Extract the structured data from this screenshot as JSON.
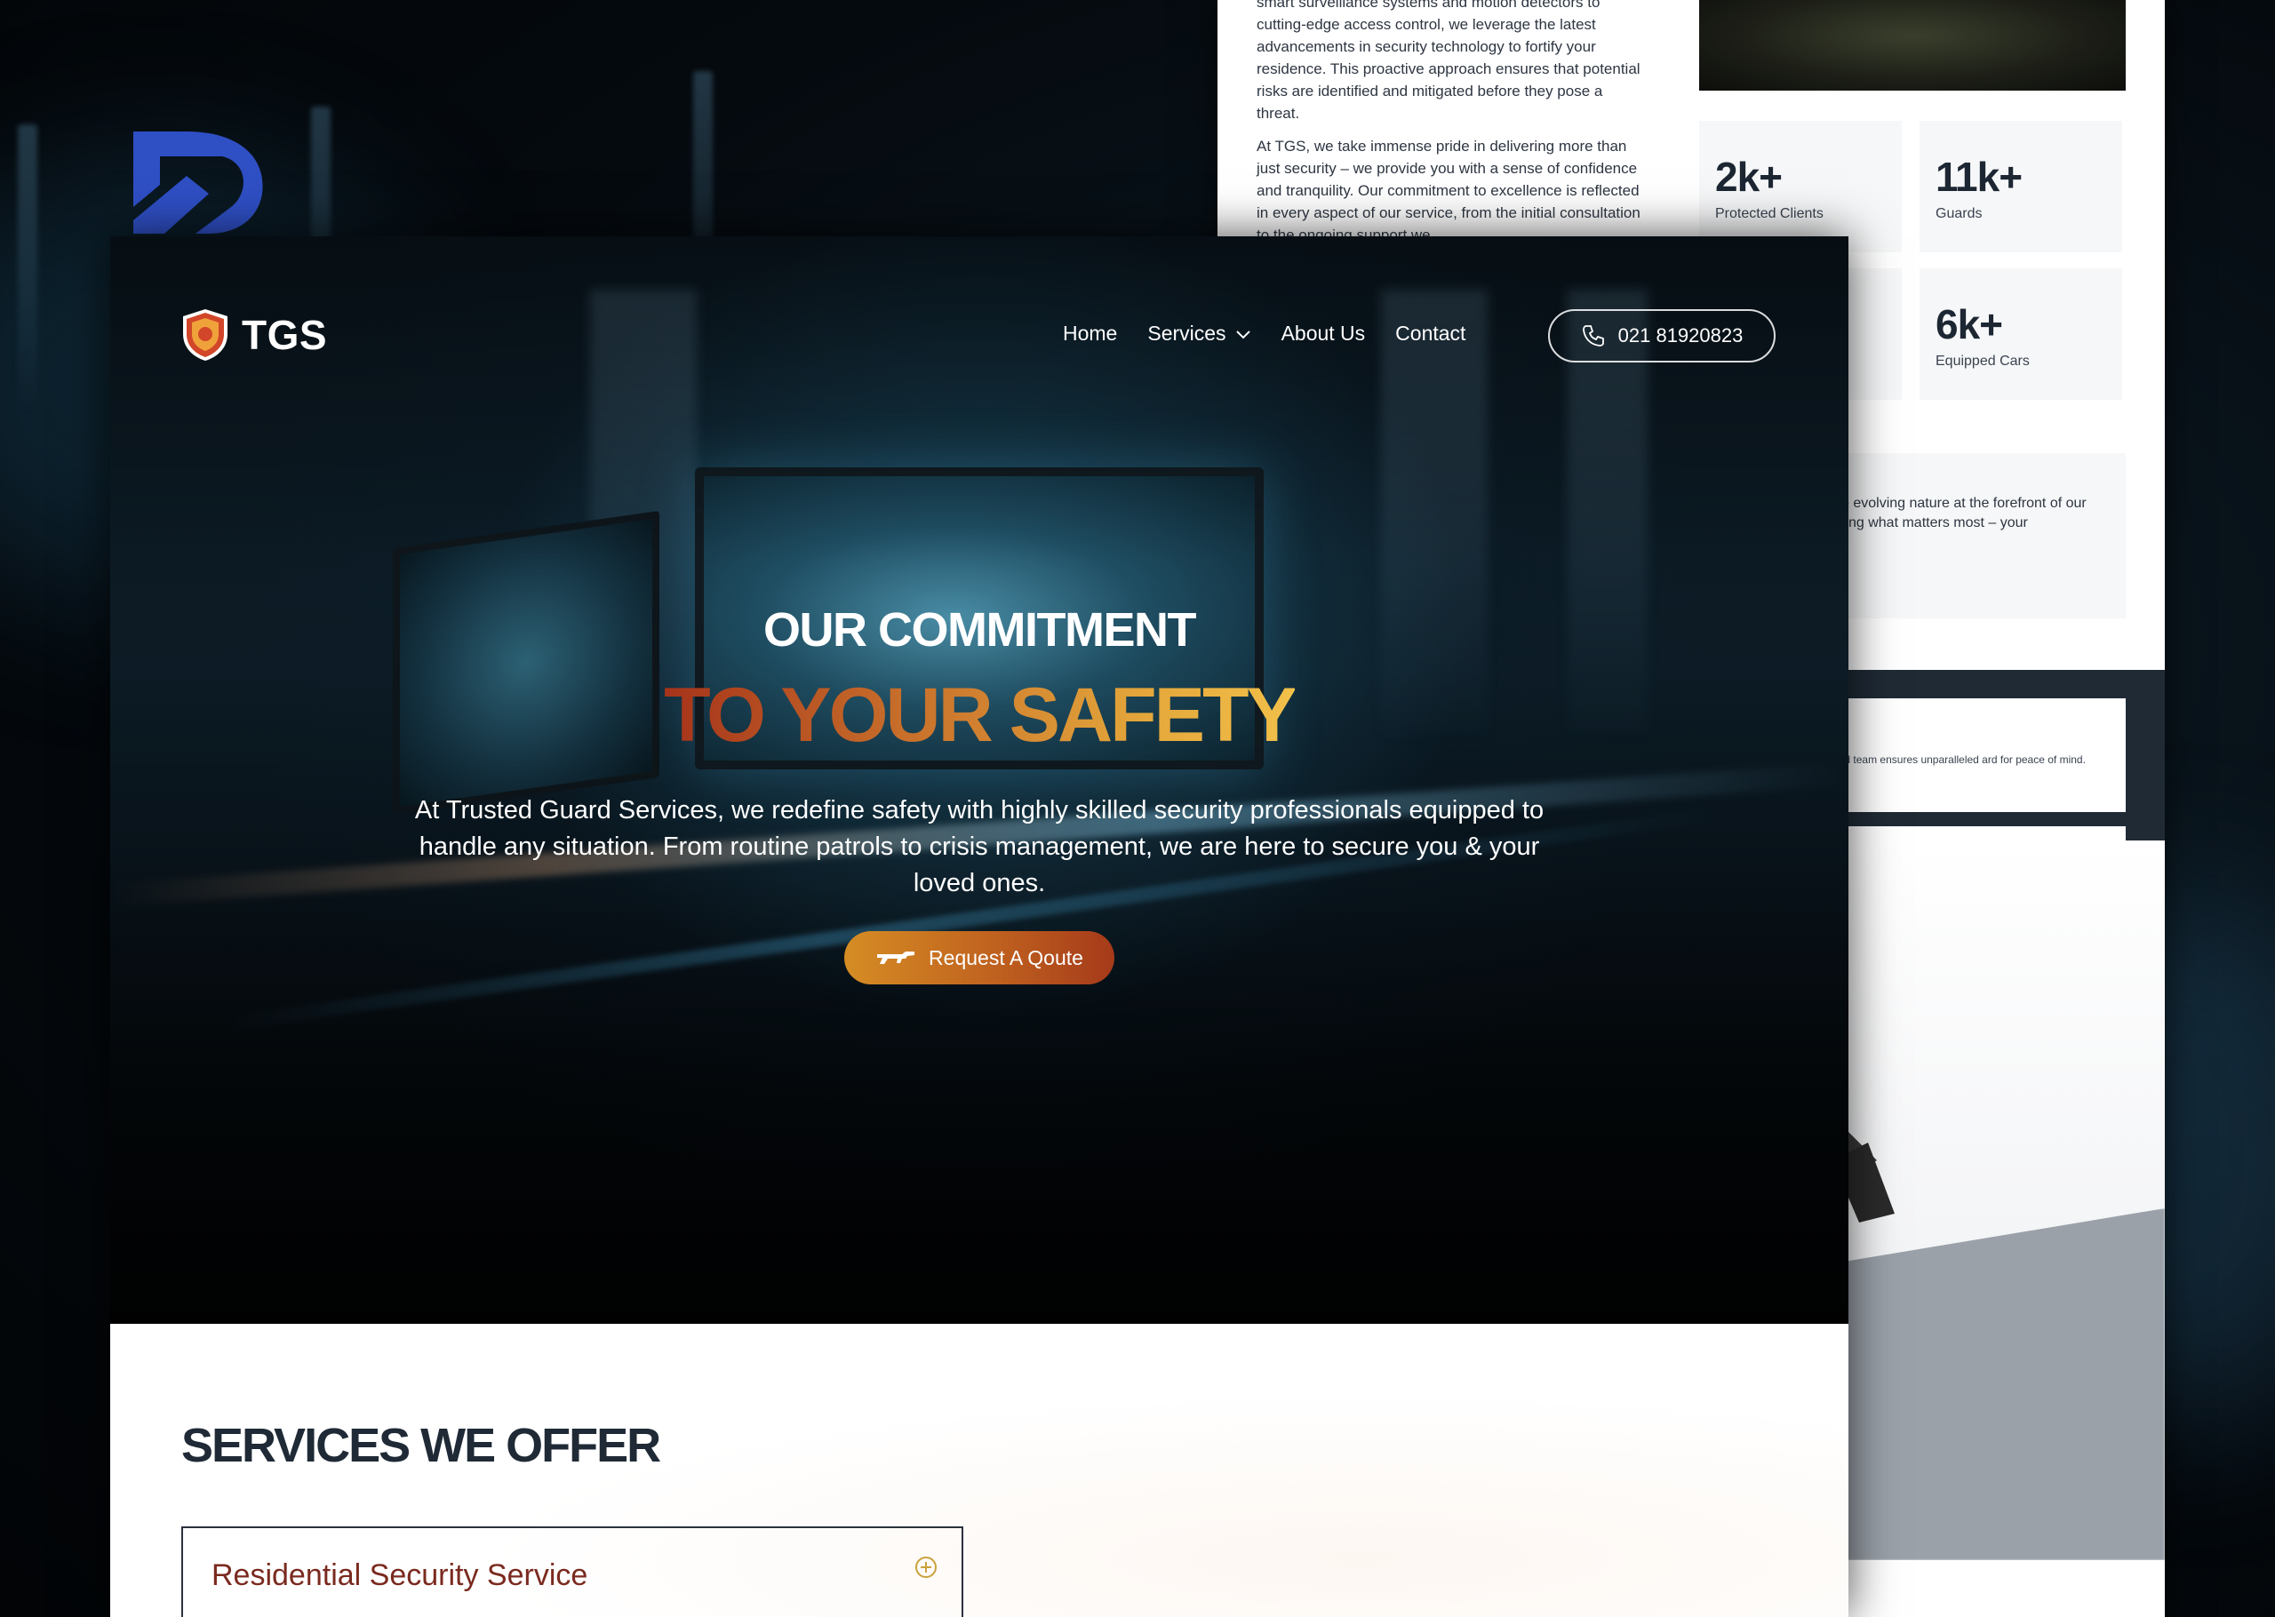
{
  "back_page": {
    "paragraph_1": "smart surveillance systems and motion detectors to cutting-edge access control, we leverage the latest advancements in security technology to fortify your residence. This proactive approach ensures that potential risks are identified and mitigated before they pose a threat.",
    "paragraph_2": "At TGS, we take immense pride in delivering more than just security – we provide you with a sense of confidence and tranquility. Our commitment to excellence is reflected in every aspect of our service, from the initial consultation to the ongoing support we",
    "stats": [
      {
        "value": "2k+",
        "label": "Protected Clients"
      },
      {
        "value": "11k+",
        "label": "Guards"
      },
      {
        "value": "6k+",
        "label": "Equipped Cars"
      }
    ],
    "gray_block_text": "We understand the evolving nature at the forefront of our efforts. With guarding what matters most – your",
    "white_card_text": "excellence, our dedicated team ensures unparalleled ard for peace of mind."
  },
  "header": {
    "logo_text": "TGS",
    "nav": [
      {
        "label": "Home"
      },
      {
        "label": "Services"
      },
      {
        "label": "About Us"
      },
      {
        "label": "Contact"
      }
    ],
    "phone": "021 81920823"
  },
  "hero": {
    "heading_line1": "OUR COMMITMENT",
    "heading_line2": "TO YOUR SAFETY",
    "description": "At Trusted Guard Services, we redefine safety with highly skilled security professionals equipped to handle any situation. From routine patrols to crisis management, we are here to secure you & your loved ones.",
    "cta_label": "Request A Qoute"
  },
  "services": {
    "title": "SERVICES WE OFFER",
    "items": [
      {
        "label": "Residential Security Service"
      }
    ]
  },
  "colors": {
    "accent_orange": "#d68d24",
    "accent_red": "#a53a1a",
    "dark_navy": "#1f2a36",
    "brand_blue": "#2f4fc4"
  },
  "icons": {
    "brand": "brand-mark-icon",
    "logo": "shield-icon",
    "dropdown": "chevron-down-icon",
    "phone": "phone-icon",
    "cta": "rifle-icon",
    "accordion": "plus-circle-icon"
  }
}
